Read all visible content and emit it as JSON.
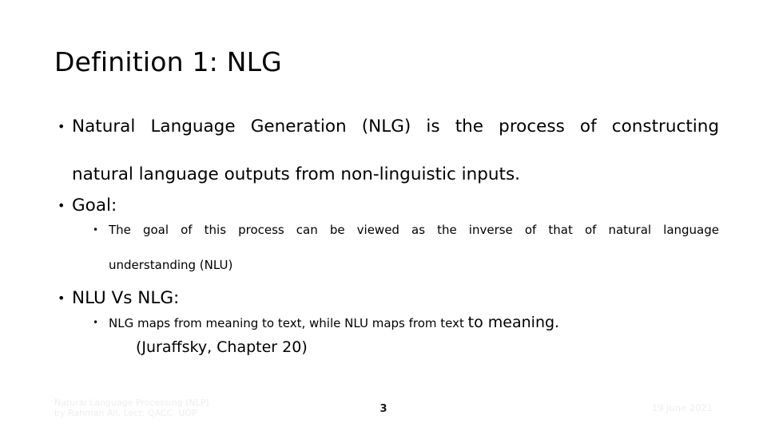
{
  "slide": {
    "title": "Definition 1: NLG",
    "background_color": "#ffffff",
    "text_color": "#000000"
  },
  "content": {
    "bullet1": {
      "bullet_glyph": "•",
      "line1": "Natural Language Generation (NLG) is the process of constructing",
      "line2": "natural language outputs from non-linguistic inputs."
    },
    "bullet2": {
      "bullet_glyph": "•",
      "label": "Goal:"
    },
    "bullet2_sub": {
      "bullet_glyph": "•",
      "line1": "The goal of this process can be viewed as the inverse of that of natural language",
      "line2": "understanding (NLU)"
    },
    "bullet3": {
      "bullet_glyph": "•",
      "label": "NLU Vs NLG:"
    },
    "bullet3_sub": {
      "bullet_glyph": "•",
      "line1_small": "NLG maps from meaning to text, while NLU maps from text ",
      "line1_large": "to meaning.",
      "citation": "(Juraffsky, Chapter 20)"
    }
  },
  "footer": {
    "left_text": "Natural Language Processing (NLP)\nby Rahman Ali, Lect: QACC, UOP",
    "page_number": "3",
    "date": "19 June 2021",
    "muted_color": "#eeeeee"
  }
}
